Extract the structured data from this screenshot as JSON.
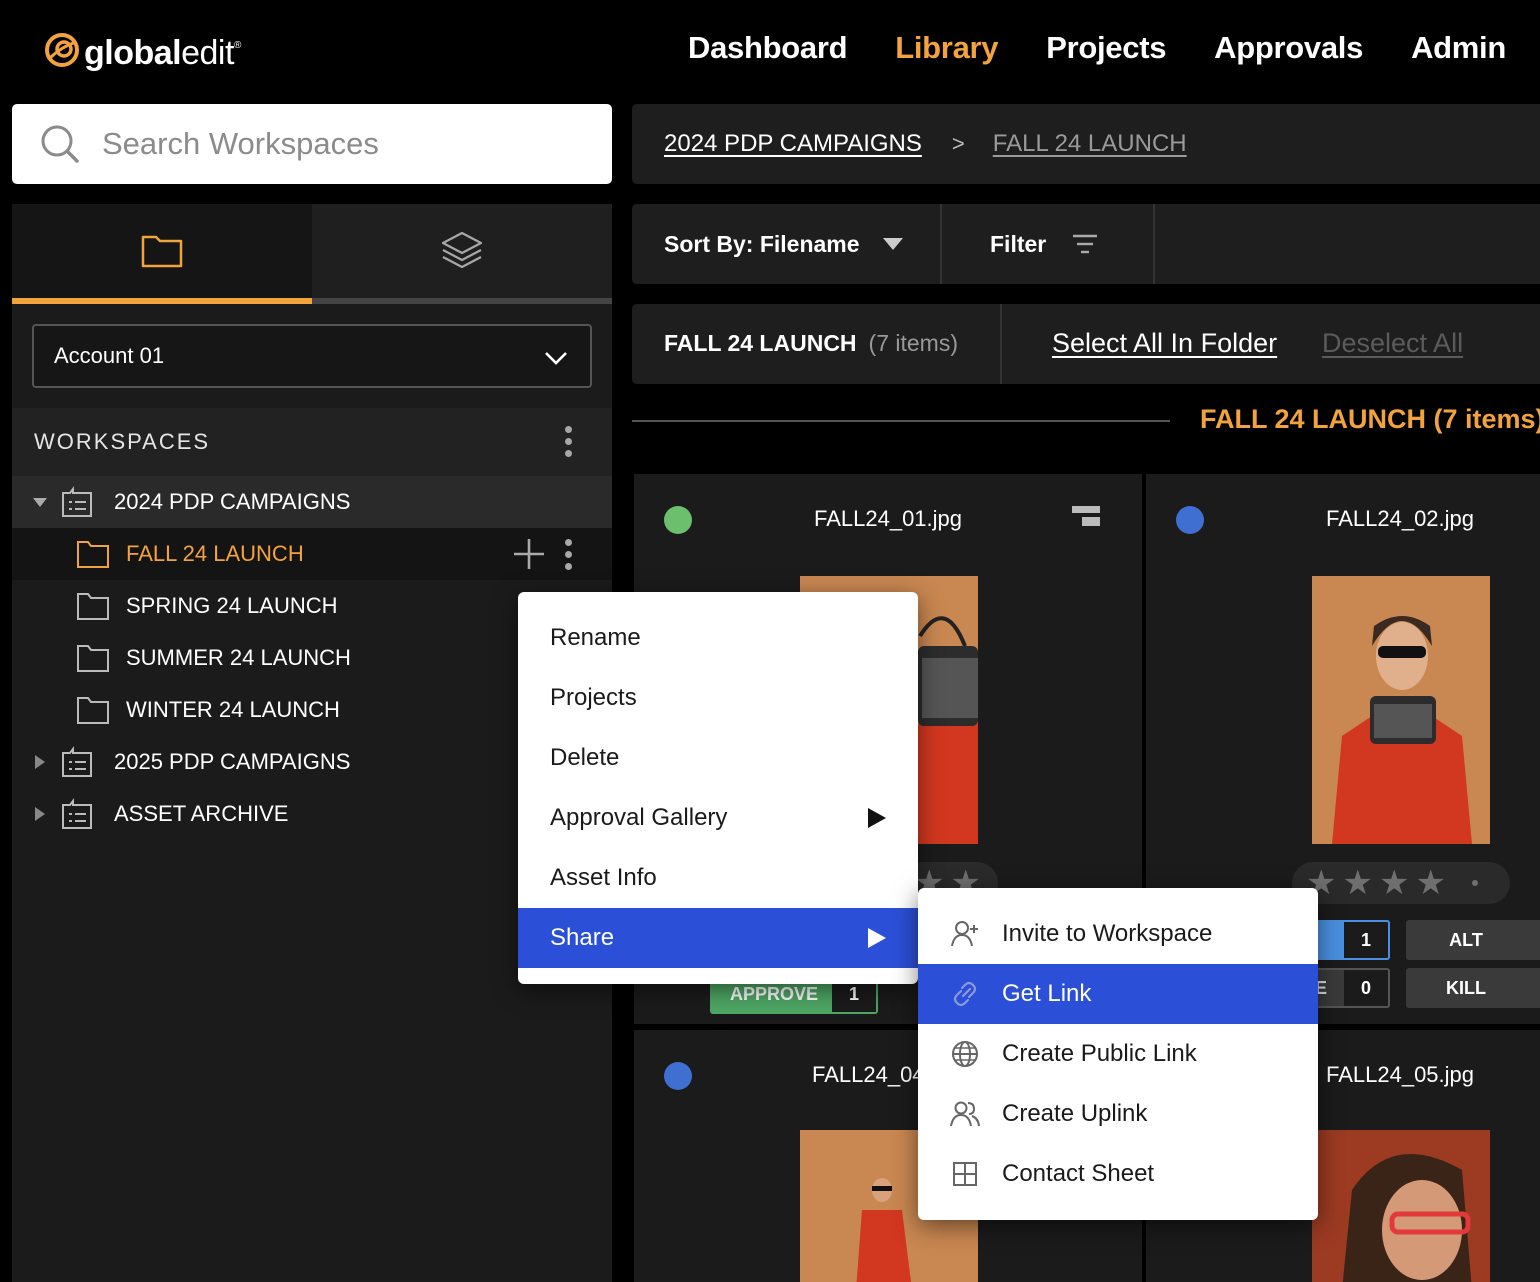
{
  "brand": {
    "name_bold": "global",
    "name_light": "edit",
    "mark": "®",
    "accent": "#f3a33d"
  },
  "nav": {
    "items": [
      {
        "label": "Dashboard",
        "active": false
      },
      {
        "label": "Library",
        "active": true
      },
      {
        "label": "Projects",
        "active": false
      },
      {
        "label": "Approvals",
        "active": false
      },
      {
        "label": "Admin",
        "active": false
      }
    ]
  },
  "search": {
    "placeholder": "Search Workspaces",
    "value": ""
  },
  "sidebar": {
    "tabs": [
      {
        "icon": "folder-icon",
        "active": true
      },
      {
        "icon": "layers-icon",
        "active": false
      }
    ],
    "account": "Account 01",
    "workspaces_label": "WORKSPACES",
    "tree": [
      {
        "label": "2024 PDP CAMPAIGNS",
        "expanded": true,
        "type": "workspace"
      },
      {
        "label": "FALL 24 LAUNCH",
        "type": "folder",
        "selected": true
      },
      {
        "label": "SPRING 24 LAUNCH",
        "type": "folder"
      },
      {
        "label": "SUMMER 24 LAUNCH",
        "type": "folder"
      },
      {
        "label": "WINTER 24 LAUNCH",
        "type": "folder"
      },
      {
        "label": "2025 PDP CAMPAIGNS",
        "expanded": false,
        "type": "workspace"
      },
      {
        "label": "ASSET ARCHIVE",
        "expanded": false,
        "type": "workspace"
      }
    ]
  },
  "breadcrumb": {
    "items": [
      "2024 PDP CAMPAIGNS",
      "FALL 24 LAUNCH"
    ]
  },
  "toolbar": {
    "sort_label": "Sort By: Filename",
    "filter_label": "Filter"
  },
  "folder_bar": {
    "name": "FALL 24 LAUNCH",
    "count": "(7 items)",
    "select_all": "Select All In Folder",
    "deselect_all": "Deselect All"
  },
  "section_title": "FALL 24 LAUNCH (7 items)",
  "assets": [
    {
      "filename": "FALL24_01.jpg",
      "status_color": "#6cbf6c",
      "approve_label": "APPROVE",
      "approve_count": "1"
    },
    {
      "filename": "FALL24_02.jpg",
      "status_color": "#3f6fd1",
      "rating_count": "1",
      "rating_count_b": "0",
      "alt_label": "ALT",
      "kill_label": "KILL"
    },
    {
      "filename": "FALL24_04.jpg",
      "status_color": "#3f6fd1"
    },
    {
      "filename": "FALL24_05.jpg"
    }
  ],
  "context_menu": {
    "items": [
      {
        "label": "Rename"
      },
      {
        "label": "Projects"
      },
      {
        "label": "Delete"
      },
      {
        "label": "Approval Gallery",
        "submenu": true
      },
      {
        "label": "Asset Info"
      },
      {
        "label": "Share",
        "submenu": true,
        "highlighted": true
      }
    ]
  },
  "share_menu": {
    "items": [
      {
        "label": "Invite to Workspace",
        "icon": "user-plus-icon"
      },
      {
        "label": "Get Link",
        "icon": "link-icon",
        "highlighted": true
      },
      {
        "label": "Create Public Link",
        "icon": "globe-icon"
      },
      {
        "label": "Create Uplink",
        "icon": "users-icon"
      },
      {
        "label": "Contact Sheet",
        "icon": "grid-icon"
      }
    ]
  },
  "colors": {
    "highlight": "#2b4fd6",
    "panel": "#1b1b1b",
    "approve": "#4ea764"
  }
}
